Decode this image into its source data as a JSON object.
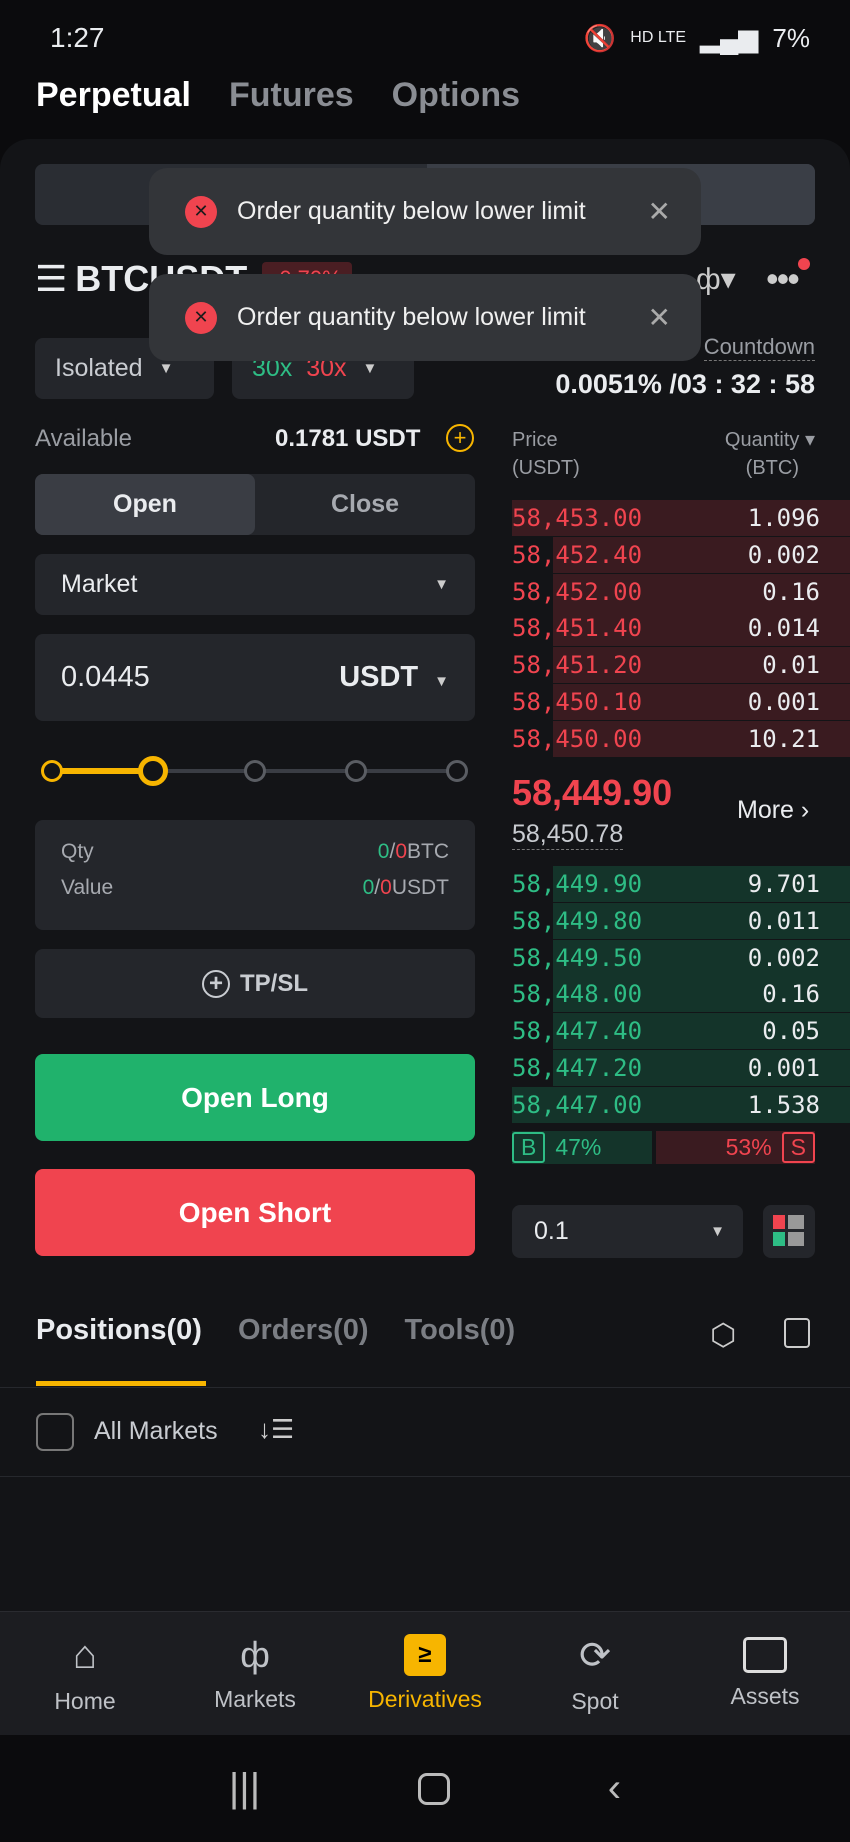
{
  "status": {
    "time": "1:27",
    "battery": "7%",
    "net": "HD LTE"
  },
  "top_tabs": [
    {
      "label": "Perpetual",
      "active": true
    },
    {
      "label": "Futures",
      "active": false
    },
    {
      "label": "Options",
      "active": false
    }
  ],
  "toasts": [
    {
      "message": "Order quantity below lower limit"
    },
    {
      "message": "Order quantity below lower limit"
    }
  ],
  "symbol": {
    "name": "BTCUSDT",
    "change": "-0.70%"
  },
  "margin_mode": "Isolated",
  "leverage": {
    "long": "30x",
    "short": "30x"
  },
  "funding": {
    "label": "Countdown",
    "value": "0.0051% /03 : 32 : 58"
  },
  "available": {
    "label": "Available",
    "value": "0.1781 USDT"
  },
  "order_side_tabs": [
    {
      "label": "Open",
      "active": true
    },
    {
      "label": "Close",
      "active": false
    }
  ],
  "order_type": "Market",
  "amount": {
    "value": "0.0445",
    "unit": "USDT"
  },
  "slider": {
    "percent": 25,
    "stops": [
      0,
      25,
      50,
      75,
      100
    ]
  },
  "summary": {
    "qty_label": "Qty",
    "qty_value": "0",
    "qty_max": "0",
    "qty_unit": "BTC",
    "value_label": "Value",
    "value_value": "0",
    "value_max": "0",
    "value_unit": "USDT"
  },
  "tpsl_label": "TP/SL",
  "open_long": "Open Long",
  "open_short": "Open Short",
  "orderbook": {
    "price_header": "Price",
    "price_unit": "(USDT)",
    "qty_header": "Quantity",
    "qty_unit": "(BTC)",
    "asks": [
      {
        "price": "58,453.00",
        "qty": "1.096",
        "depth": 1.0
      },
      {
        "price": "58,452.40",
        "qty": "0.002",
        "depth": 0.88
      },
      {
        "price": "58,452.00",
        "qty": "0.16",
        "depth": 0.88
      },
      {
        "price": "58,451.40",
        "qty": "0.014",
        "depth": 0.88
      },
      {
        "price": "58,451.20",
        "qty": "0.01",
        "depth": 0.88
      },
      {
        "price": "58,450.10",
        "qty": "0.001",
        "depth": 0.88
      },
      {
        "price": "58,450.00",
        "qty": "10.21",
        "depth": 0.88
      }
    ],
    "last_price": "58,449.90",
    "mark_price": "58,450.78",
    "more": "More",
    "bids": [
      {
        "price": "58,449.90",
        "qty": "9.701",
        "depth": 0.88
      },
      {
        "price": "58,449.80",
        "qty": "0.011",
        "depth": 0.88
      },
      {
        "price": "58,449.50",
        "qty": "0.002",
        "depth": 0.88
      },
      {
        "price": "58,448.00",
        "qty": "0.16",
        "depth": 0.88
      },
      {
        "price": "58,447.40",
        "qty": "0.05",
        "depth": 0.88
      },
      {
        "price": "58,447.20",
        "qty": "0.001",
        "depth": 0.88
      },
      {
        "price": "58,447.00",
        "qty": "1.538",
        "depth": 1.0
      }
    ],
    "buy_label": "B",
    "buy_pct": "47%",
    "sell_label": "S",
    "sell_pct": "53%",
    "precision": "0.1"
  },
  "bottom_tabs": [
    {
      "label": "Positions(0)",
      "active": true
    },
    {
      "label": "Orders(0)",
      "active": false
    },
    {
      "label": "Tools(0)",
      "active": false
    }
  ],
  "all_markets": "All Markets",
  "nav": [
    {
      "label": "Home",
      "icon": "home-icon"
    },
    {
      "label": "Markets",
      "icon": "candlestick-icon"
    },
    {
      "label": "Derivatives",
      "icon": "derivatives-icon",
      "active": true
    },
    {
      "label": "Spot",
      "icon": "spot-icon"
    },
    {
      "label": "Assets",
      "icon": "wallet-icon"
    }
  ],
  "colors": {
    "green": "#2ebd85",
    "red": "#f0444f",
    "accent": "#f7b500"
  }
}
